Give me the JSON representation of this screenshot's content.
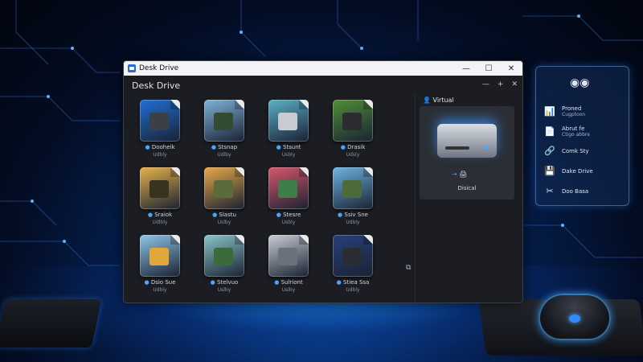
{
  "window": {
    "title": "Desk Drive",
    "header_title": "Desk Drive",
    "controls": {
      "minimize": "—",
      "maximize": "☐",
      "close": "✕"
    }
  },
  "panel_controls": {
    "minimize": "—",
    "add": "+",
    "close": "✕"
  },
  "tiles": [
    {
      "label": "Dooheik",
      "sub": "Udbly",
      "color": "#1f6fd6",
      "obj": "#3b3f47"
    },
    {
      "label": "Stsnap",
      "sub": "Udlby",
      "color": "#7fb3d8",
      "obj": "#334a33"
    },
    {
      "label": "Stsunt",
      "sub": "Usbly",
      "color": "#5bb0c8",
      "obj": "#c8ccd2"
    },
    {
      "label": "Drasik",
      "sub": "Udsly",
      "color": "#4f8f37",
      "obj": "#2a2c30"
    },
    {
      "label": "Sraiok",
      "sub": "Udlbly",
      "color": "#e7b24a",
      "obj": "#3a3221"
    },
    {
      "label": "Slastu",
      "sub": "Uslby",
      "color": "#e8a84a",
      "obj": "#5c6b3a"
    },
    {
      "label": "Stesre",
      "sub": "Usbly",
      "color": "#d8576b",
      "obj": "#3f7d4a"
    },
    {
      "label": "Ssiv Sne",
      "sub": "Udbly",
      "color": "#6fb3e0",
      "obj": "#4c6a3a"
    },
    {
      "label": "Dsio Sue",
      "sub": "Udbly",
      "color": "#90c6e8",
      "obj": "#e0a83b"
    },
    {
      "label": "Stelvuo",
      "sub": "Uslby",
      "color": "#8ac6c9",
      "obj": "#3b6b3a"
    },
    {
      "label": "Sulriont",
      "sub": "Uslby",
      "color": "#c9ced6",
      "obj": "#6c727c"
    },
    {
      "label": "Stiea Ssa",
      "sub": "Udbly",
      "color": "#28407a",
      "obj": "#2b2d33"
    }
  ],
  "virtual": {
    "title": "Virtual",
    "drive_label": "Disical",
    "arrow": "⇢"
  },
  "side_panel": {
    "items": [
      {
        "title": "Proned",
        "sub": "Cugptoon",
        "icon": "📊"
      },
      {
        "title": "Abrut fe",
        "sub": "Ctigo abbre",
        "icon": "📄"
      },
      {
        "title": "Comk Sty",
        "sub": "",
        "icon": "🔗"
      },
      {
        "title": "Dake Drive",
        "sub": "",
        "icon": "💾"
      },
      {
        "title": "Doo Basa",
        "sub": "",
        "icon": "✂"
      }
    ]
  }
}
